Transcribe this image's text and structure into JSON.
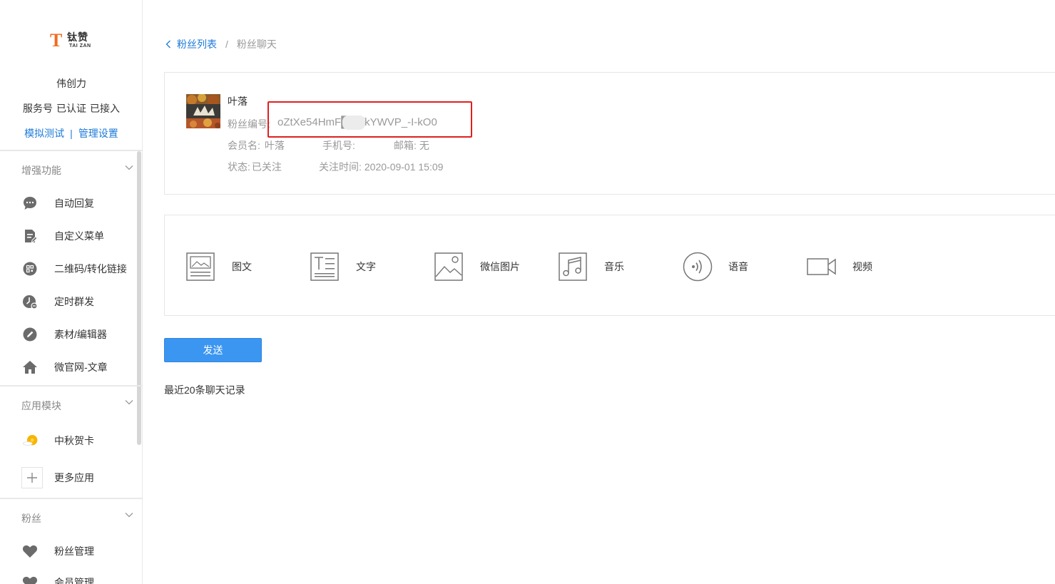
{
  "logo": {
    "mark": "T",
    "name_cn": "钛赞",
    "name_en": "TAI ZAN"
  },
  "account": {
    "name": "伟创力",
    "type": "服务号",
    "verified": "已认证",
    "connected": "已接入",
    "links": {
      "simulate": "模拟测试",
      "separator": "|",
      "settings": "管理设置"
    }
  },
  "sidebar": {
    "sections": [
      {
        "title": "增强功能",
        "items": [
          {
            "label": "自动回复",
            "icon": "chat-bubble-icon"
          },
          {
            "label": "自定义菜单",
            "icon": "menu-edit-icon"
          },
          {
            "label": "二维码/转化链接",
            "icon": "qrcode-icon"
          },
          {
            "label": "定时群发",
            "icon": "clock-icon"
          },
          {
            "label": "素材/编辑器",
            "icon": "pencil-icon"
          },
          {
            "label": "微官网-文章",
            "icon": "home-icon"
          }
        ]
      },
      {
        "title": "应用模块",
        "items": [
          {
            "label": "中秋贺卡",
            "icon": "moon-cake-icon"
          },
          {
            "label": "更多应用",
            "icon": "plus-icon"
          }
        ]
      },
      {
        "title": "粉丝",
        "items": [
          {
            "label": "粉丝管理",
            "icon": "heart-icon"
          },
          {
            "label": "会员管理",
            "icon": "heart-icon"
          }
        ]
      }
    ]
  },
  "breadcrumb": {
    "parent": "粉丝列表",
    "separator": "/",
    "current": "粉丝聊天"
  },
  "fan": {
    "name": "叶落",
    "id_label": "粉丝编号:",
    "id_value": "oZtXe54HmF██kfkYWVP_-I-kO0",
    "member_label": "会员名:",
    "member_value": "叶落",
    "phone_label": "手机号:",
    "phone_value": "",
    "email_label": "邮箱:",
    "email_value": "无",
    "status_label": "状态:",
    "status_value": "已关注",
    "follow_label": "关注时间:",
    "follow_value": "2020-09-01 15:09"
  },
  "message_types": [
    {
      "label": "图文",
      "icon": "news-icon"
    },
    {
      "label": "文字",
      "icon": "text-icon"
    },
    {
      "label": "微信图片",
      "icon": "image-icon"
    },
    {
      "label": "音乐",
      "icon": "music-icon"
    },
    {
      "label": "语音",
      "icon": "voice-icon"
    },
    {
      "label": "视频",
      "icon": "video-icon"
    }
  ],
  "actions": {
    "send": "发送"
  },
  "history": {
    "title": "最近20条聊天记录"
  },
  "colors": {
    "accent": "#1d7ad9",
    "button": "#3b96f1",
    "logo": "#f26b1d",
    "highlight": "#e02020"
  }
}
